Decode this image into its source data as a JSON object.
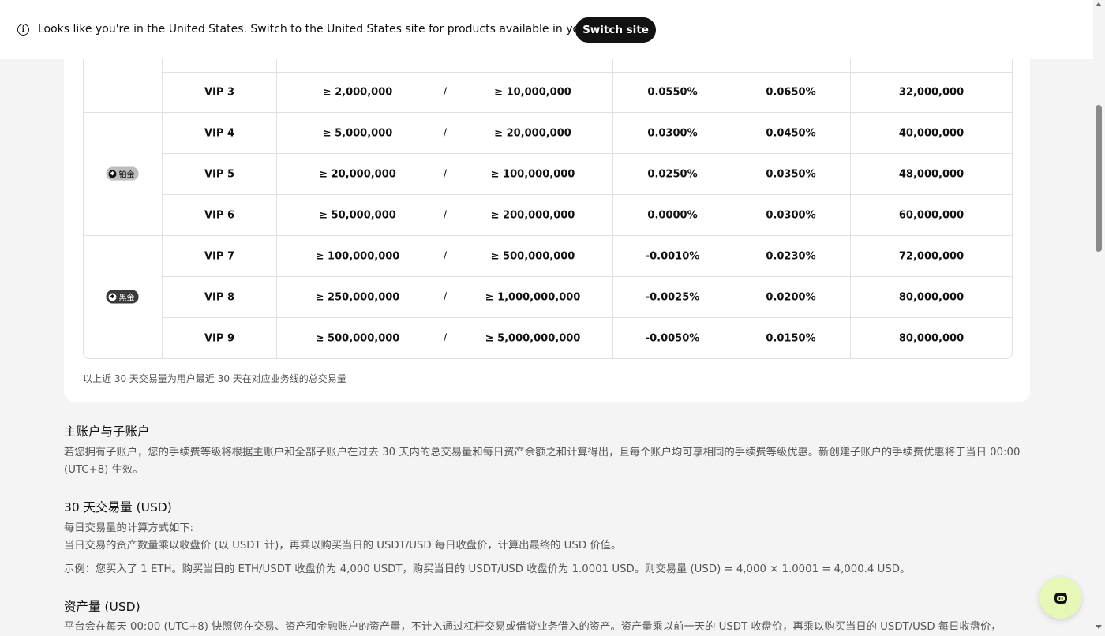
{
  "banner": {
    "message": "Looks like you're in the United States. Switch to the United States site for products available in your region.",
    "button_label": "Switch site",
    "info_icon": "info-icon"
  },
  "fee_table": {
    "separator": "/",
    "tiers": [
      {
        "name": "铂金",
        "style": "platinum"
      },
      {
        "name": "黑金",
        "style": "black"
      }
    ],
    "rows": [
      {
        "level": "VIP 3",
        "volume": "≥ 2,000,000",
        "assets": "≥ 10,000,000",
        "maker": "0.0550%",
        "taker": "0.0650%",
        "limit": "32,000,000"
      },
      {
        "level": "VIP 4",
        "volume": "≥ 5,000,000",
        "assets": "≥ 20,000,000",
        "maker": "0.0300%",
        "taker": "0.0450%",
        "limit": "40,000,000"
      },
      {
        "level": "VIP 5",
        "volume": "≥ 20,000,000",
        "assets": "≥ 100,000,000",
        "maker": "0.0250%",
        "taker": "0.0350%",
        "limit": "48,000,000"
      },
      {
        "level": "VIP 6",
        "volume": "≥ 50,000,000",
        "assets": "≥ 200,000,000",
        "maker": "0.0000%",
        "taker": "0.0300%",
        "limit": "60,000,000"
      },
      {
        "level": "VIP 7",
        "volume": "≥ 100,000,000",
        "assets": "≥ 500,000,000",
        "maker": "-0.0010%",
        "taker": "0.0230%",
        "limit": "72,000,000"
      },
      {
        "level": "VIP 8",
        "volume": "≥ 250,000,000",
        "assets": "≥ 1,000,000,000",
        "maker": "-0.0025%",
        "taker": "0.0200%",
        "limit": "80,000,000"
      },
      {
        "level": "VIP 9",
        "volume": "≥ 500,000,000",
        "assets": "≥ 5,000,000,000",
        "maker": "-0.0050%",
        "taker": "0.0150%",
        "limit": "80,000,000"
      }
    ],
    "footnote": "以上近 30 天交易量为用户最近 30 天在对应业务线的总交易量"
  },
  "sections": {
    "sub_accounts": {
      "title": "主账户与子账户",
      "body": "若您拥有子账户，您的手续费等级将根据主账户和全部子账户在过去 30 天内的总交易量和每日资产余额之和计算得出，且每个账户均可享相同的手续费等级优惠。新创建子账户的手续费优惠将于当日 00:00 (UTC+8) 生效。"
    },
    "volume": {
      "title": "30 天交易量 (USD)",
      "line1": "每日交易量的计算方式如下:",
      "line2": "当日交易的资产数量乘以收盘价 (以 USDT 计)，再乘以购买当日的 USDT/USD 每日收盘价，计算出最终的 USD 价值。",
      "example": "示例：您买入了 1 ETH。购买当日的 ETH/USDT 收盘价为 4,000 USDT，购买当日的 USDT/USD 收盘价为 1.0001 USD。则交易量 (USD) = 4,000 × 1.0001 = 4,000.4 USD。"
    },
    "assets": {
      "title": "资产量 (USD)",
      "body": "平台会在每天 00:00 (UTC+8) 快照您在交易、资产和金融账户的资产量，不计入通过杠杆交易或借贷业务借入的资产。资产量乘以前一天的 USDT 收盘价，再乘以购买当日的 USDT/USD 每日收盘价，"
    }
  },
  "support": {
    "icon": "headset-icon"
  }
}
